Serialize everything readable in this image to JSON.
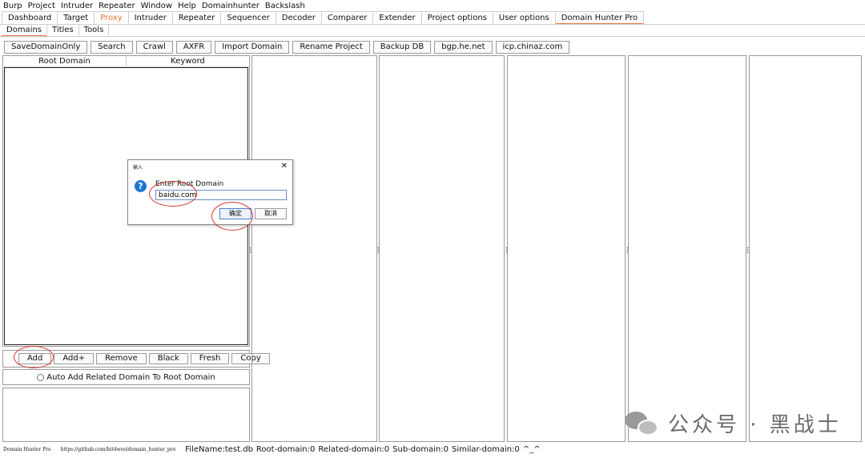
{
  "menu": [
    "Burp",
    "Project",
    "Intruder",
    "Repeater",
    "Window",
    "Help",
    "Domainhunter",
    "Backslash"
  ],
  "top_tabs": [
    "Dashboard",
    "Target",
    "Proxy",
    "Intruder",
    "Repeater",
    "Sequencer",
    "Decoder",
    "Comparer",
    "Extender",
    "Project options",
    "User options",
    "Domain Hunter Pro"
  ],
  "sub_tabs": [
    "Domains",
    "Titles",
    "Tools"
  ],
  "toolbar": [
    "SaveDomainOnly",
    "Search",
    "Crawl",
    "AXFR",
    "Import Domain",
    "Rename Project",
    "Backup DB",
    "bgp.he.net",
    "icp.chinaz.com"
  ],
  "table": {
    "columns": [
      "Root Domain",
      "Keyword"
    ]
  },
  "buttons": [
    "Add",
    "Add+",
    "Remove",
    "Black",
    "Fresh",
    "Copy"
  ],
  "auto_add_label": "Auto Add Related Domain To Root Domain",
  "status": {
    "app_name": "Domain Hunter Pro",
    "url": "https://github.com/bit4woo/domain_hunter_pro",
    "file": "FileName:test.db",
    "root": "Root-domain:0",
    "related": "Related-domain:0",
    "sub": "Sub-domain:0",
    "similar": "Similar-domain:0",
    "face": "^_^"
  },
  "dialog": {
    "title": "输入",
    "close": "✕",
    "label": "Enter Root Domain",
    "value": "baidu.com",
    "ok": "确定",
    "cancel": "取消"
  },
  "watermark": "公众号 · 黑战士",
  "colors": {
    "accent": "#e8743b",
    "annotation": "#d2352d",
    "info_icon": "#1a76d2"
  }
}
